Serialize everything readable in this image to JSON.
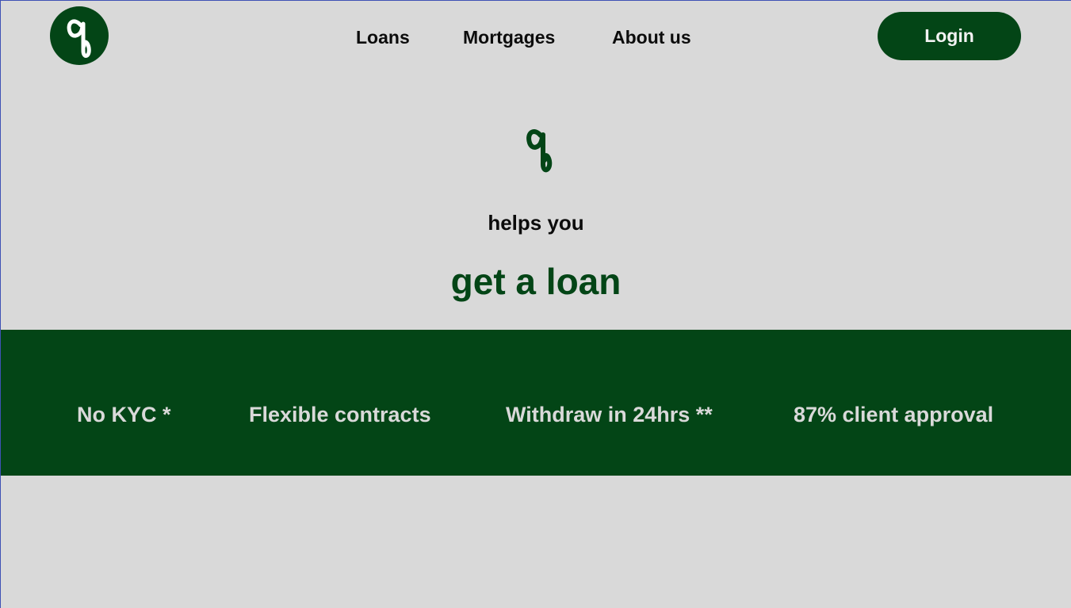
{
  "header": {
    "logo_icon": "script-q-logo-icon",
    "nav": [
      {
        "label": "Loans"
      },
      {
        "label": "Mortgages"
      },
      {
        "label": "About us"
      }
    ],
    "login_label": "Login"
  },
  "hero": {
    "mark_icon": "script-q-mark-icon",
    "subtitle": "helps you",
    "title": "get a loan"
  },
  "features": [
    {
      "label": "No KYC *"
    },
    {
      "label": "Flexible contracts"
    },
    {
      "label": "Withdraw in 24hrs **"
    },
    {
      "label": "87% client approval"
    }
  ],
  "colors": {
    "brand_green": "#034516",
    "background": "#d9d9d9",
    "text_dark": "#0c0c0c",
    "text_light": "#f2f2f2"
  }
}
